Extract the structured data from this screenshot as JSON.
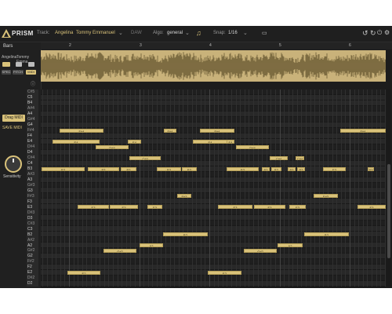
{
  "app": {
    "name": "PRISM",
    "daw_label": "DAW"
  },
  "topbar": {
    "track_label": "Track:",
    "track_values": [
      "Angelina",
      "Tommy Emmanuel"
    ],
    "algo_label": "Algo:",
    "algo_value": "general",
    "snap_label": "Snap:",
    "snap_value": "1/16",
    "icons": [
      "note-icon",
      "screen-icon",
      "undo-icon",
      "redo-icon",
      "power-icon",
      "settings-icon",
      "help-icon"
    ]
  },
  "left": {
    "track_name_1": "Angelina",
    "track_name_2": "Tommy Emma...",
    "tabs": [
      "SPEC",
      "PITCH",
      "MIDI"
    ],
    "drag_midi": "Drag MIDI",
    "save_midi": "SAVE MIDI",
    "sensitivity": "Sensitivity",
    "active_tab": "MIDI"
  },
  "bars_label": "Bars",
  "bar_numbers": [
    "2",
    "3",
    "4",
    "5",
    "6"
  ],
  "keys": [
    "C#5",
    "C5",
    "B4",
    "A#4",
    "A4",
    "G#4",
    "G4",
    "F#4",
    "F4",
    "E4",
    "D#4",
    "D4",
    "C#4",
    "C4",
    "B3",
    "A#3",
    "A3",
    "G#3",
    "G3",
    "F#3",
    "F3",
    "E3",
    "D#3",
    "D3",
    "C#3",
    "C3",
    "B2",
    "A#2",
    "A2",
    "G#2",
    "G2",
    "F#2",
    "F2",
    "E2",
    "D#2",
    "D2"
  ],
  "notes": [
    {
      "label": "F#4",
      "key": "F#4"
    },
    {
      "label": "F#4",
      "key": "F#4"
    },
    {
      "label": "F#4",
      "key": "F#4"
    },
    {
      "label": "F#4",
      "key": "F#4"
    },
    {
      "label": "E4",
      "key": "E4"
    },
    {
      "label": "E4",
      "key": "E4"
    },
    {
      "label": "E4",
      "key": "E4"
    },
    {
      "label": "E4",
      "key": "E4"
    },
    {
      "label": "D#4",
      "key": "D#4"
    },
    {
      "label": "D#4",
      "key": "D#4"
    },
    {
      "label": "C#4",
      "key": "C#4"
    },
    {
      "label": "C#4",
      "key": "C#4"
    },
    {
      "label": "C#4",
      "key": "C#4"
    },
    {
      "label": "B3",
      "key": "B3"
    },
    {
      "label": "B3",
      "key": "B3"
    },
    {
      "label": "B3",
      "key": "B3"
    },
    {
      "label": "B3",
      "key": "B3"
    },
    {
      "label": "B3",
      "key": "B3"
    },
    {
      "label": "B3",
      "key": "B3"
    },
    {
      "label": "B3",
      "key": "B3"
    },
    {
      "label": "B3",
      "key": "B3"
    },
    {
      "label": "B3",
      "key": "B3"
    },
    {
      "label": "B3",
      "key": "B3"
    },
    {
      "label": "E3",
      "key": "B3"
    },
    {
      "label": "B3",
      "key": "B3"
    },
    {
      "label": "F#3",
      "key": "F#3"
    },
    {
      "label": "F#3",
      "key": "F#3"
    },
    {
      "label": "E3",
      "key": "E3"
    },
    {
      "label": "E3",
      "key": "E3"
    },
    {
      "label": "E3",
      "key": "E3"
    },
    {
      "label": "E3",
      "key": "E3"
    },
    {
      "label": "E3",
      "key": "E3"
    },
    {
      "label": "E3",
      "key": "E3"
    },
    {
      "label": "E3",
      "key": "E3"
    },
    {
      "label": "B2",
      "key": "B2"
    },
    {
      "label": "B2",
      "key": "B2"
    },
    {
      "label": "A2",
      "key": "A2"
    },
    {
      "label": "A2",
      "key": "A2"
    },
    {
      "label": "G#2",
      "key": "G#2"
    },
    {
      "label": "G#2",
      "key": "G#2"
    },
    {
      "label": "E2",
      "key": "E2"
    },
    {
      "label": "E2",
      "key": "E2"
    }
  ],
  "colors": {
    "accent": "#d9c27a",
    "background": "#1c1c1c",
    "roll": "#262626"
  }
}
